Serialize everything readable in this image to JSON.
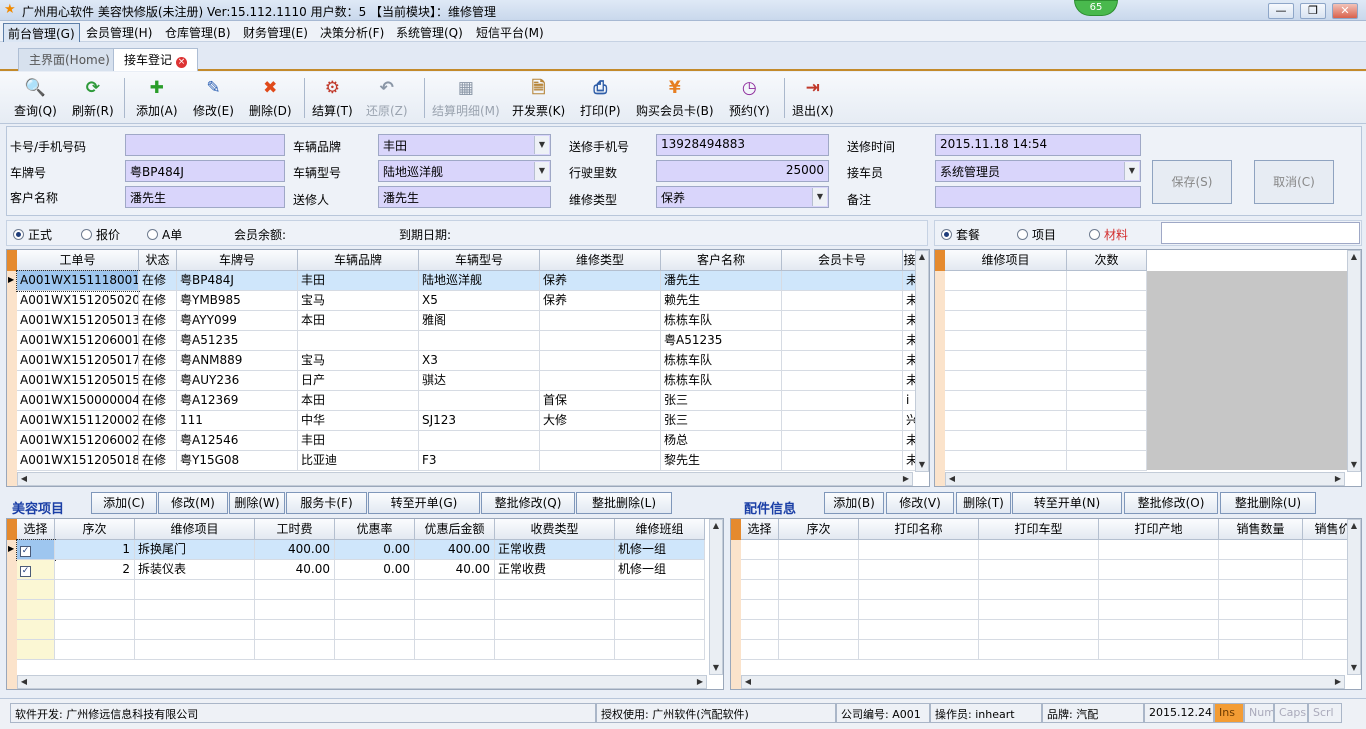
{
  "titlebar": {
    "title": "广州用心软件 美容快修版(未注册) Ver:15.112.1110 用户数：5 【当前模块】：维修管理",
    "badge": "65",
    "min": "—",
    "restore": "❐",
    "close": "✕"
  },
  "menu": [
    "前台管理(G)",
    "会员管理(H)",
    "仓库管理(B)",
    "财务管理(E)",
    "决策分析(F)",
    "系统管理(Q)",
    "短信平台(M)"
  ],
  "tabs": {
    "home": "主界面(Home)",
    "current": "接车登记",
    "close": "×"
  },
  "toolbar": [
    {
      "label": "查询(Q)",
      "icon": "magnifier-icon",
      "glyph": "🔍",
      "color": "#e0a21b"
    },
    {
      "label": "刷新(R)",
      "icon": "refresh-icon",
      "glyph": "⟳",
      "color": "#2e9a3a"
    },
    {
      "label": "添加(A)",
      "icon": "plus-icon",
      "glyph": "✚",
      "color": "#2a9d2a"
    },
    {
      "label": "修改(E)",
      "icon": "pencil-icon",
      "glyph": "✎",
      "color": "#2b5fb3"
    },
    {
      "label": "删除(D)",
      "icon": "delete-icon",
      "glyph": "✖",
      "color": "#e04a1a"
    },
    {
      "label": "结算(T)",
      "icon": "checkout-icon",
      "glyph": "⚙",
      "color": "#c0392b"
    },
    {
      "label": "还原(Z)",
      "icon": "undo-icon",
      "glyph": "↶",
      "color": "#8a96a6"
    },
    {
      "label": "结算明细(M)",
      "icon": "table-icon",
      "glyph": "▦",
      "color": "#8a96a6"
    },
    {
      "label": "开发票(K)",
      "icon": "invoice-icon",
      "glyph": "🗎",
      "color": "#b7863a"
    },
    {
      "label": "打印(P)",
      "icon": "printer-icon",
      "glyph": "⎙",
      "color": "#2f5ea8"
    },
    {
      "label": "购买会员卡(B)",
      "icon": "yen-icon",
      "glyph": "¥",
      "color": "#e67e22"
    },
    {
      "label": "预约(Y)",
      "icon": "clock-icon",
      "glyph": "◷",
      "color": "#8e2c9c"
    },
    {
      "label": "退出(X)",
      "icon": "exit-icon",
      "glyph": "⇥",
      "color": "#c0392b"
    }
  ],
  "form": {
    "card_label": "卡号/手机号码",
    "card_value": "",
    "plate_label": "车牌号",
    "plate_value": "粤BP484J",
    "customer_label": "客户名称",
    "customer_value": "潘先生",
    "brand_label": "车辆品牌",
    "brand_value": "丰田",
    "model_label": "车辆型号",
    "model_value": "陆地巡洋舰",
    "sender_label": "送修人",
    "sender_value": "潘先生",
    "phone_label": "送修手机号",
    "phone_value": "13928494883",
    "mileage_label": "行驶里数",
    "mileage_value": "25000",
    "repair_type_label": "维修类型",
    "repair_type_value": "保养",
    "time_label": "送修时间",
    "time_value": "2015.11.18 14:54",
    "receiver_label": "接车员",
    "receiver_value": "系统管理员",
    "note_label": "备注",
    "note_value": "",
    "save": "保存(S)",
    "cancel": "取消(C)"
  },
  "filter": {
    "formal": "正式",
    "quote": "报价",
    "a_order": "A单",
    "balance": "会员余额:",
    "expiry": "到期日期:",
    "package": "套餐",
    "item": "项目",
    "material": "材料"
  },
  "orders": {
    "columns": [
      "工单号",
      "状态",
      "车牌号",
      "车辆品牌",
      "车辆型号",
      "维修类型",
      "客户名称",
      "会员卡号",
      "接"
    ],
    "rows": [
      [
        "A001WX151118001",
        "在修",
        "粤BP484J",
        "丰田",
        "陆地巡洋舰",
        "保养",
        "潘先生",
        "",
        "未"
      ],
      [
        "A001WX151205020",
        "在修",
        "粤YMB985",
        "宝马",
        "X5",
        "保养",
        "赖先生",
        "",
        "未"
      ],
      [
        "A001WX151205013",
        "在修",
        "粤AYY099",
        "本田",
        "雅阁",
        "",
        "栋栋车队",
        "",
        "未"
      ],
      [
        "A001WX151206001",
        "在修",
        "粤A51235",
        "",
        "",
        "",
        "粤A51235",
        "",
        "未"
      ],
      [
        "A001WX151205017",
        "在修",
        "粤ANM889",
        "宝马",
        "X3",
        "",
        "栋栋车队",
        "",
        "未"
      ],
      [
        "A001WX151205015",
        "在修",
        "粤AUY236",
        "日产",
        "骐达",
        "",
        "栋栋车队",
        "",
        "未"
      ],
      [
        "A001WX150000004",
        "在修",
        "粤A12369",
        "本田",
        "",
        "首保",
        "张三",
        "",
        "i"
      ],
      [
        "A001WX151120002",
        "在修",
        "111",
        "中华",
        "SJ123",
        "大修",
        "张三",
        "",
        "兴"
      ],
      [
        "A001WX151206002",
        "在修",
        "粤A12546",
        "丰田",
        "",
        "",
        "杨总",
        "",
        "未"
      ],
      [
        "A001WX151205018",
        "在修",
        "粤Y15G08",
        "比亚迪",
        "F3",
        "",
        "黎先生",
        "",
        "未"
      ]
    ]
  },
  "package_grid": {
    "columns": [
      "维修项目",
      "次数"
    ]
  },
  "beauty": {
    "title": "美容项目",
    "buttons": [
      "添加(C)",
      "修改(M)",
      "删除(W)",
      "服务卡(F)",
      "转至开单(G)",
      "整批修改(Q)",
      "整批删除(L)"
    ],
    "columns": [
      "选择",
      "序次",
      "维修项目",
      "工时费",
      "优惠率",
      "优惠后金额",
      "收费类型",
      "维修班组"
    ],
    "rows": [
      [
        "✓",
        "1",
        "拆换尾门",
        "400.00",
        "0.00",
        "400.00",
        "正常收费",
        "机修一组"
      ],
      [
        "✓",
        "2",
        "拆装仪表",
        "40.00",
        "0.00",
        "40.00",
        "正常收费",
        "机修一组"
      ]
    ]
  },
  "parts": {
    "title": "配件信息",
    "buttons": [
      "添加(B)",
      "修改(V)",
      "删除(T)",
      "转至开单(N)",
      "整批修改(O)",
      "整批删除(U)"
    ],
    "columns": [
      "选择",
      "序次",
      "打印名称",
      "打印车型",
      "打印产地",
      "销售数量",
      "销售价"
    ]
  },
  "status": {
    "dev": "软件开发: 广州修远信息科技有限公司",
    "license": "授权使用: 广州软件(汽配软件)",
    "company": "公司编号: A001",
    "operator": "操作员: inheart",
    "brand": "品牌: 汽配",
    "date": "2015.12.24",
    "ins": "Ins",
    "num": "Num",
    "caps": "Caps",
    "scrl": "Scrl"
  },
  "colors": {
    "accent_orange": "#e58a2e",
    "input_bg": "#d9d5fb",
    "selection": "#cfe6fb",
    "section_title": "#1b3fa6"
  }
}
